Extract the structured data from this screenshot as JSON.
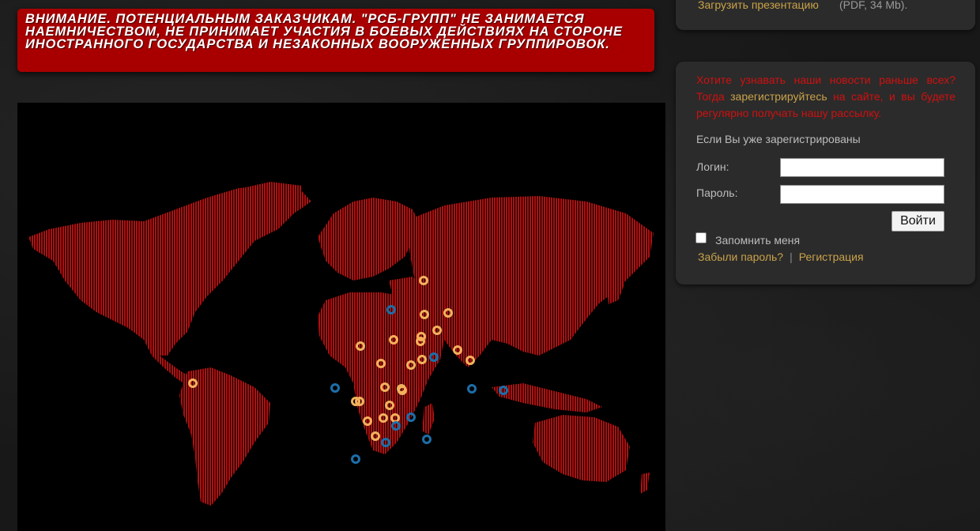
{
  "warning": {
    "text": "ВНИМАНИЕ. ПОТЕНЦИАЛЬНЫМ ЗАКАЗЧИКАМ. \"РСБ-ГРУПП\" НЕ ЗАНИМАЕТСЯ НАЕМНИЧЕСТВОМ, НЕ ПРИНИМАЕТ УЧАСТИЯ В БОЕВЫХ ДЕЙСТВИЯХ НА СТОРОНЕ ИНОСТРАННОГО ГОСУДАРСТВА И НЕЗАКОННЫХ ВООРУЖЕННЫХ ГРУППИРОВОК."
  },
  "presentation": {
    "link_label": "Загрузить презентацию",
    "meta": "(PDF, 34 Mb)."
  },
  "newsletter": {
    "text_before": "Хотите узнавать наши новости раньше всех? Тогда ",
    "register_link": "зарегистрируйтесь",
    "text_after": " на сайте, и вы будете регулярно получать нашу рассылку."
  },
  "login": {
    "already_registered": "Если Вы уже зарегистрированы",
    "login_label": "Логин:",
    "login_value": "",
    "password_label": "Пароль:",
    "password_value": "",
    "submit_label": "Войти",
    "remember_label": "Запомнить меня",
    "remember_checked": false,
    "forgot_link": "Забыли пароль?",
    "separator": "|",
    "register_link": "Регистрация"
  },
  "map": {
    "land_color": "#b01010",
    "marker_colors": {
      "orange": "#f2b25c",
      "blue": "#1c6ea8"
    },
    "markers_orange_count": 24,
    "markers_blue_count": 11
  }
}
